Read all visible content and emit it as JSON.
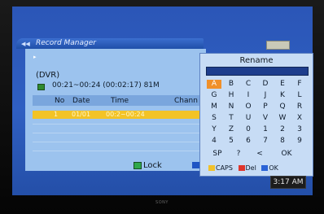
{
  "record_manager": {
    "title": "Record Manager",
    "header_right_text": "",
    "dvr_label": "(DVR)",
    "recording_info": "00:21~00:24 (00:02:17) 81M",
    "columns": [
      "No",
      "Date",
      "Time",
      "Chann"
    ],
    "rows": [
      {
        "no": "1",
        "date": "01/01",
        "time": "00:2~00:24",
        "chann": ""
      }
    ],
    "lock_label": "Lock"
  },
  "rename_dialog": {
    "title": "Rename",
    "input_value": "",
    "keys": [
      [
        "A",
        "B",
        "C",
        "D",
        "E",
        "F"
      ],
      [
        "G",
        "H",
        "I",
        "J",
        "K",
        "L"
      ],
      [
        "M",
        "N",
        "O",
        "P",
        "Q",
        "R"
      ],
      [
        "S",
        "T",
        "U",
        "V",
        "W",
        "X"
      ],
      [
        "Y",
        "Z",
        "0",
        "1",
        "2",
        "3"
      ],
      [
        "4",
        "5",
        "6",
        "7",
        "8",
        "9"
      ],
      [
        "SP",
        "?",
        "<",
        "OK"
      ]
    ],
    "selected_key": "A",
    "legend": {
      "caps": "CAPS",
      "del": "Del",
      "ok": "OK"
    }
  },
  "clock": "3:17 AM",
  "brand": "SONY",
  "colors": {
    "screen_blue": "#2f5fc2",
    "panel_light": "#9cc3ee",
    "highlight_row": "#f3c326",
    "selected_key": "#f0902a",
    "caps_yellow": "#f1c12a",
    "del_red": "#e0352b",
    "ok_blue": "#2a63d6",
    "lock_green": "#2fa84a"
  }
}
